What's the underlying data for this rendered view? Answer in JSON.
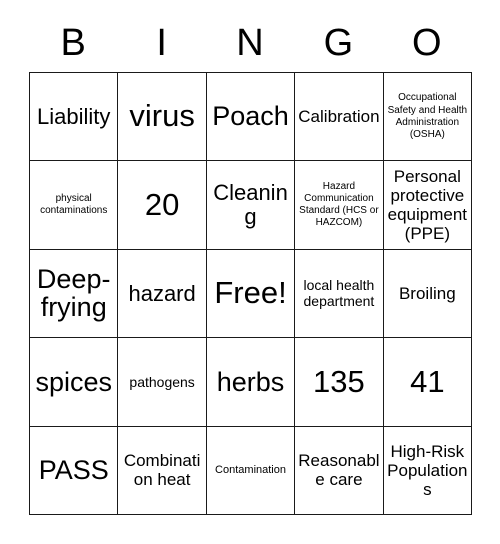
{
  "card": {
    "header_letters": [
      "B",
      "I",
      "N",
      "G",
      "O"
    ],
    "rows": [
      [
        {
          "text": "Liability",
          "size": "lg"
        },
        {
          "text": "virus",
          "size": "xxl"
        },
        {
          "text": "Poach",
          "size": "xl"
        },
        {
          "text": "Calibration",
          "size": "md"
        },
        {
          "text": "Occupational Safety and Health Administration (OSHA)",
          "size": "xxs"
        }
      ],
      [
        {
          "text": "physical contaminations",
          "size": "xxs"
        },
        {
          "text": "20",
          "size": "xxl"
        },
        {
          "text": "Cleaning",
          "size": "lg"
        },
        {
          "text": "Hazard Communication Standard (HCS or HAZCOM)",
          "size": "xxs"
        },
        {
          "text": "Personal protective equipment (PPE)",
          "size": "md"
        }
      ],
      [
        {
          "text": "Deep-frying",
          "size": "xl"
        },
        {
          "text": "hazard",
          "size": "lg"
        },
        {
          "text": "Free!",
          "size": "xxl"
        },
        {
          "text": "local health department",
          "size": "sm"
        },
        {
          "text": "Broiling",
          "size": "md"
        }
      ],
      [
        {
          "text": "spices",
          "size": "xl"
        },
        {
          "text": "pathogens",
          "size": "sm"
        },
        {
          "text": "herbs",
          "size": "xl"
        },
        {
          "text": "135",
          "size": "xxl"
        },
        {
          "text": "41",
          "size": "xxl"
        }
      ],
      [
        {
          "text": "PASS",
          "size": "xl"
        },
        {
          "text": "Combination heat",
          "size": "md"
        },
        {
          "text": "Contamination",
          "size": "xs"
        },
        {
          "text": "Reasonable care",
          "size": "md"
        },
        {
          "text": "High-Risk Populations",
          "size": "md"
        }
      ]
    ]
  }
}
